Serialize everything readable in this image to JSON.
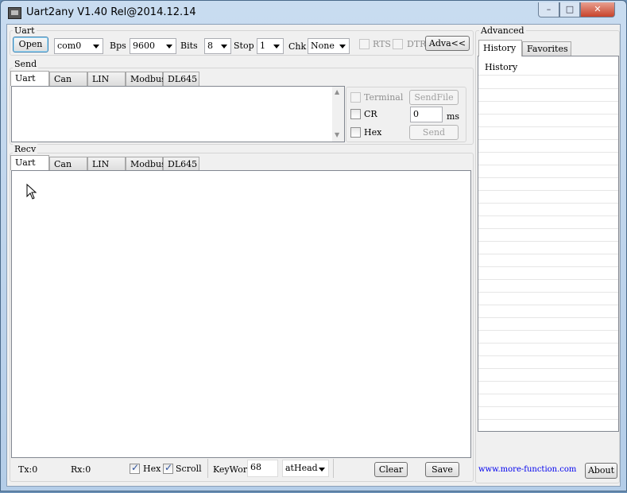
{
  "window": {
    "title": "Uart2any V1.40 Rel@2014.12.14",
    "min": "–",
    "max": "□",
    "close": "✕"
  },
  "uart": {
    "label": "Uart",
    "open": "Open",
    "port": "com0",
    "bps_label": "Bps",
    "bps": "9600",
    "bits_label": "Bits",
    "bits": "8",
    "stop_label": "Stop",
    "stop": "1",
    "chk_label": "Chk",
    "chk": "None",
    "rts": "RTS",
    "dtr": "DTR",
    "adva": "Adva<<"
  },
  "send": {
    "label": "Send",
    "tabs": [
      "Uart",
      "Can",
      "LIN",
      "Modbus",
      "DL645"
    ],
    "terminal": "Terminal",
    "sendfile": "SendFile",
    "cr": "CR",
    "interval": "0",
    "ms": "ms",
    "hex": "Hex",
    "send": "Send"
  },
  "recv": {
    "label": "Recv",
    "tabs": [
      "Uart",
      "Can",
      "LIN",
      "Modbus",
      "DL645"
    ]
  },
  "status": {
    "tx": "Tx:0",
    "rx": "Rx:0",
    "hex": "Hex",
    "hex_checked": true,
    "scroll": "Scroll",
    "scroll_checked": true,
    "keyword_label": "KeyWord",
    "keyword": "68",
    "position": "atHead",
    "clear": "Clear",
    "save": "Save"
  },
  "advanced": {
    "label": "Advanced",
    "tabs": [
      "History",
      "Favorites"
    ],
    "list_header": "History",
    "link": "www.more-function.com",
    "about": "About"
  }
}
